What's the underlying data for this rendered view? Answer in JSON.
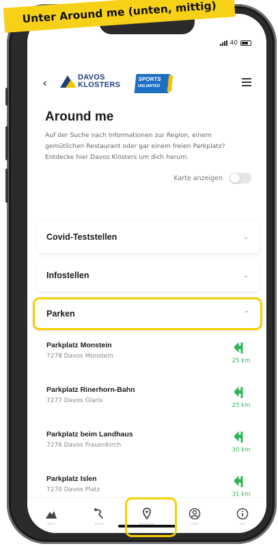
{
  "annotation": {
    "banner_text": "Unter Around me (unten, mittig)",
    "highlight_color": "#f5d000"
  },
  "status_bar": {
    "network": "40"
  },
  "header": {
    "back_icon": "chevron-left-icon",
    "brand_logo_line1": "DAVOS",
    "brand_logo_line2": "KLOSTERS",
    "partner_logo_line1": "SPORTS",
    "partner_logo_line2": "UNLIMITED",
    "menu_icon": "hamburger-icon"
  },
  "page": {
    "title": "Around me",
    "intro": "Auf der Suche nach Informationen zur Region, einem gemütlichen Restaurant oder gar einem freien Parkplatz? Entdecke hier Davos Klosters um dich herum.",
    "map_toggle_label": "Karte anzeigen",
    "map_toggle_on": false
  },
  "accordion": [
    {
      "title": "Covid-Teststellen",
      "open": false
    },
    {
      "title": "Infostellen",
      "open": false
    },
    {
      "title": "Parken",
      "open": true
    }
  ],
  "parking": [
    {
      "name": "Parkplatz Monstein",
      "address": "7278 Davos Monstein",
      "distance": "25 km"
    },
    {
      "name": "Parkplatz Rinerhorn-Bahn",
      "address": "7277 Davos Glaris",
      "distance": "25 km"
    },
    {
      "name": "Parkplatz beim Landhaus",
      "address": "7276 Davos Frauenkirch",
      "distance": "30 km"
    },
    {
      "name": "Parkplatz Islen",
      "address": "7270 Davos Platz",
      "distance": "31 km"
    }
  ],
  "colors": {
    "accent_green": "#2fb45a",
    "brand_blue": "#1d3c7a"
  },
  "bottom_nav": [
    {
      "icon": "mountain-icon",
      "label": "Home"
    },
    {
      "icon": "route-icon",
      "label": "Touren"
    },
    {
      "icon": "location-pin-icon",
      "label": "Around me",
      "active": true
    },
    {
      "icon": "profile-icon",
      "label": "Profil"
    },
    {
      "icon": "info-icon",
      "label": "Info"
    }
  ]
}
